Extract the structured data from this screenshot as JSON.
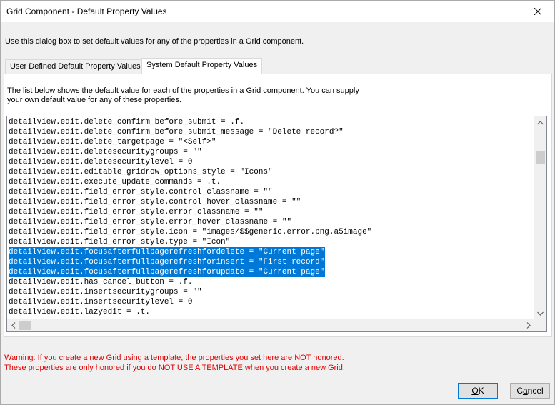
{
  "window": {
    "title": "Grid Component - Default Property Values",
    "instructions": "Use this dialog box to set default values for any of the properties in a Grid component."
  },
  "tabs": [
    {
      "label": "User Defined Default Property Values",
      "active": false
    },
    {
      "label": "System Default Property Values",
      "active": true
    }
  ],
  "panel": {
    "description_line1": "The list below shows the default value for each of the properties in a Grid component. You can supply",
    "description_line2": "your own default value for any of these properties."
  },
  "code_lines": [
    {
      "text": "detailview.edit.delete_confirm_before_submit = .f.",
      "selected": false
    },
    {
      "text": "detailview.edit.delete_confirm_before_submit_message = \"Delete record?\"",
      "selected": false
    },
    {
      "text": "detailview.edit.delete_targetpage = \"<Self>\"",
      "selected": false
    },
    {
      "text": "detailview.edit.deletesecuritygroups = \"\"",
      "selected": false
    },
    {
      "text": "detailview.edit.deletesecuritylevel = 0",
      "selected": false
    },
    {
      "text": "detailview.edit.editable_gridrow_options_style = \"Icons\"",
      "selected": false
    },
    {
      "text": "detailview.edit.execute_update_commands = .t.",
      "selected": false
    },
    {
      "text": "detailview.edit.field_error_style.control_classname = \"\"",
      "selected": false
    },
    {
      "text": "detailview.edit.field_error_style.control_hover_classname = \"\"",
      "selected": false
    },
    {
      "text": "detailview.edit.field_error_style.error_classname = \"\"",
      "selected": false
    },
    {
      "text": "detailview.edit.field_error_style.error_hover_classname = \"\"",
      "selected": false
    },
    {
      "text": "detailview.edit.field_error_style.icon = \"images/$$generic.error.png.a5image\"",
      "selected": false
    },
    {
      "text": "detailview.edit.field_error_style.type = \"Icon\"",
      "selected": false
    },
    {
      "text": "detailview.edit.focusafterfullpagerefreshfordelete = \"Current page\"",
      "selected": true
    },
    {
      "text": "detailview.edit.focusafterfullpagerefreshforinsert = \"First record\"",
      "selected": true
    },
    {
      "text": "detailview.edit.focusafterfullpagerefreshforupdate = \"Current page\"",
      "selected": true
    },
    {
      "text": "detailview.edit.has_cancel_button = .f.",
      "selected": false
    },
    {
      "text": "detailview.edit.insertsecuritygroups = \"\"",
      "selected": false
    },
    {
      "text": "detailview.edit.insertsecuritylevel = 0",
      "selected": false
    },
    {
      "text": "detailview.edit.lazyedit = .t.",
      "selected": false
    }
  ],
  "warning": {
    "line1": "Warning: If you create a new Grid using a template, the properties you set here are NOT honored.",
    "line2": "These properties are only honored if you do NOT USE A TEMPLATE when you create a new Grid."
  },
  "buttons": {
    "ok": {
      "mnemonic": "O",
      "rest": "K"
    },
    "cancel": {
      "prefix": "C",
      "mnemonic": "a",
      "rest": "ncel"
    }
  },
  "icons": {
    "close": "close-icon",
    "scroll_up": "chevron-up-icon",
    "scroll_down": "chevron-down-icon",
    "scroll_left": "chevron-left-icon",
    "scroll_right": "chevron-right-icon"
  },
  "colors": {
    "selection": "#0078d7",
    "warning": "#e00000"
  }
}
